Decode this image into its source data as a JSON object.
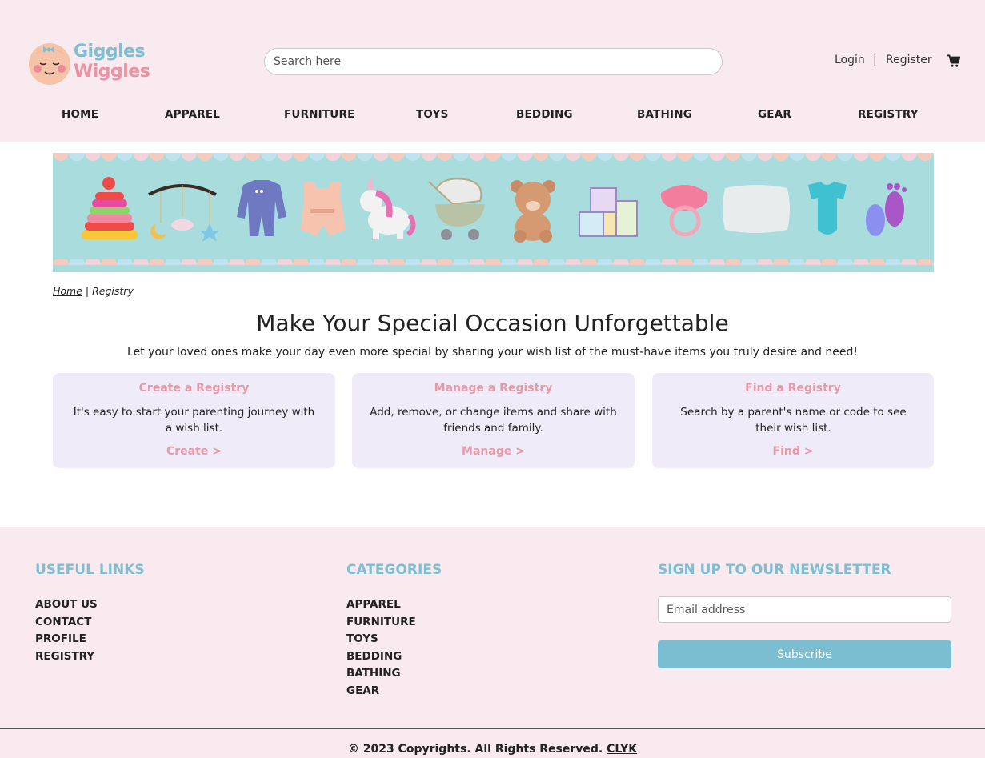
{
  "brand": {
    "line1": "Giggles",
    "line2": "Wiggles"
  },
  "search": {
    "placeholder": "Search here"
  },
  "account": {
    "login": "Login",
    "separator": "|",
    "register": "Register"
  },
  "nav": [
    "HOME",
    "APPAREL",
    "FURNITURE",
    "TOYS",
    "BEDDING",
    "BATHING",
    "GEAR",
    "REGISTRY"
  ],
  "breadcrumb": {
    "home": "Home",
    "separator": "|",
    "current": "Registry"
  },
  "hero": {
    "title": "Make Your Special Occasion Unforgettable",
    "subtitle": "Let your loved ones make your day even more special by sharing your wish list of the must-have items you truly desire and need!"
  },
  "cards": [
    {
      "title": "Create a Registry",
      "text": "It's easy to start your parenting journey with a wish list.",
      "link": "Create >"
    },
    {
      "title": "Manage a Registry",
      "text": "Add, remove, or change items and share with friends and family.",
      "link": "Manage >"
    },
    {
      "title": "Find a Registry",
      "text": "Search by a parent's name or code to see their wish list.",
      "link": "Find >"
    }
  ],
  "footer": {
    "useful_links": {
      "heading": "USEFUL LINKS",
      "items": [
        "ABOUT US",
        "CONTACT",
        "PROFILE",
        "REGISTRY"
      ]
    },
    "categories": {
      "heading": "CATEGORIES",
      "items": [
        "APPAREL",
        "FURNITURE",
        "TOYS",
        "BEDDING",
        "BATHING",
        "GEAR"
      ]
    },
    "newsletter": {
      "heading": "SIGN UP TO OUR NEWSLETTER",
      "placeholder": "Email address",
      "button": "Subscribe"
    },
    "copyright": "© 2023 Copyrights. All Rights Reserved.",
    "copyright_link": "CLYK"
  },
  "colors": {
    "header_bg": "#f8eaef",
    "accent_blue": "#7dbed1",
    "accent_pink": "#e79aa6",
    "card_bg": "#efebf9",
    "banner_bg": "#a9dcdd"
  },
  "icons": {
    "cart": "cart-icon",
    "logo": "baby-face-logo"
  }
}
